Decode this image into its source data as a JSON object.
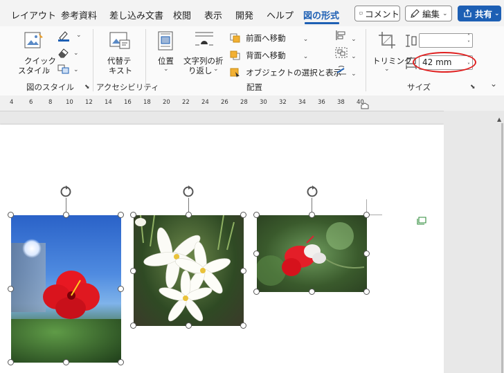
{
  "tabs": [
    {
      "label": "レイアウト",
      "active": false
    },
    {
      "label": "参考資料",
      "active": false
    },
    {
      "label": "差し込み文書",
      "active": false
    },
    {
      "label": "校閲",
      "active": false
    },
    {
      "label": "表示",
      "active": false
    },
    {
      "label": "開発",
      "active": false
    },
    {
      "label": "ヘルプ",
      "active": false
    },
    {
      "label": "図の形式",
      "active": true
    }
  ],
  "topbar": {
    "comment_label": "コメント",
    "edit_label": "編集",
    "share_label": "共有"
  },
  "ribbon": {
    "quick_style_line1": "クイック",
    "quick_style_line2": "スタイル",
    "alt_text_line1": "代替テ",
    "alt_text_line2": "キスト",
    "position_label": "位置",
    "wrap_text_line1": "文字列の折",
    "wrap_text_line2": "り返し",
    "bring_forward_label": "前面へ移動",
    "send_backward_label": "背面へ移動",
    "selection_pane_label": "オブジェクトの選択と表示",
    "crop_label": "トリミング",
    "height_value": "",
    "width_value": "42 mm",
    "groups": {
      "picture_styles": "図のスタイル",
      "accessibility": "アクセシビリティ",
      "arrange": "配置",
      "size": "サイズ"
    }
  },
  "ruler": {
    "ticks": [
      "4",
      "6",
      "8",
      "10",
      "12",
      "14",
      "16",
      "18",
      "20",
      "22",
      "24",
      "26",
      "28",
      "30",
      "32",
      "34",
      "36",
      "38",
      "40"
    ]
  },
  "colors": {
    "accent": "#1d5fb4",
    "share_button": "#1d5fb4",
    "highlight_circle": "#e02020"
  },
  "icons": {
    "comment": "speech-bubble-icon",
    "edit": "pencil-icon",
    "share": "share-icon",
    "rotate": "rotate-handle-icon",
    "layout_options": "layout-options-icon"
  }
}
